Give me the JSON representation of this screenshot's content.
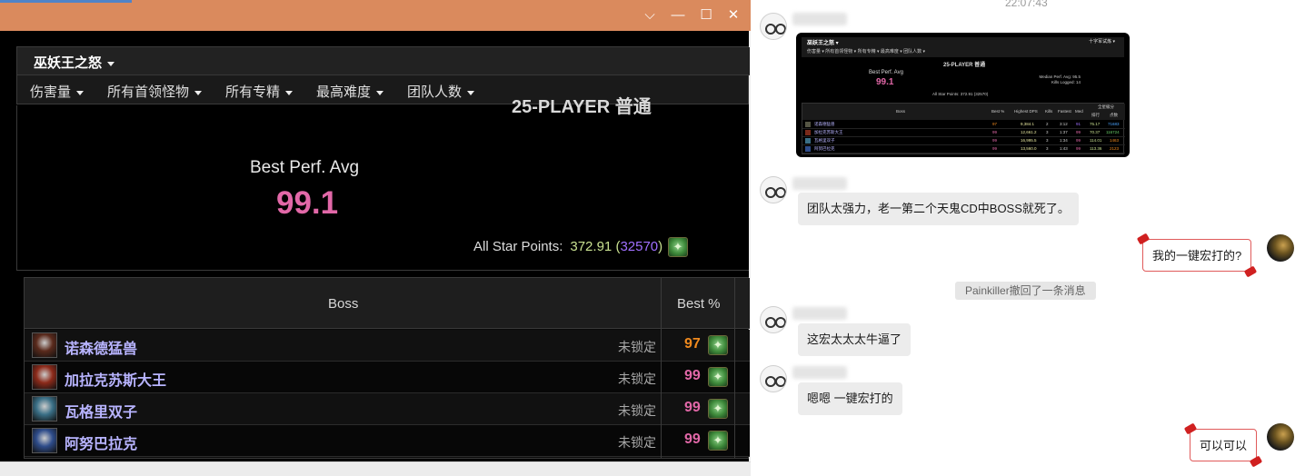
{
  "window": {
    "controls": {
      "minimize": "⌵",
      "restore": "—",
      "maximize": "☐",
      "close": "✕"
    }
  },
  "nav": {
    "zone": "巫妖王之怒",
    "filters": [
      "伤害量",
      "所有首领怪物",
      "所有专精",
      "最高难度",
      "团队人数"
    ]
  },
  "summary": {
    "difficulty": "25-PLAYER 普通",
    "best_perf_label": "Best Perf. Avg",
    "best_perf_value": "99.1",
    "all_star_label": "All Star Points:",
    "all_star_value": "372.91",
    "all_star_open": "(",
    "all_star_rank": "32570",
    "all_star_close": ")"
  },
  "table": {
    "headers": {
      "boss": "Boss",
      "best": "Best %"
    },
    "rows": [
      {
        "name": "诺森德猛兽",
        "lock": "未锁定",
        "best": "97",
        "best_color": "#f08a1e",
        "icon_color": "#5a2a1c"
      },
      {
        "name": "加拉克苏斯大王",
        "lock": "未锁定",
        "best": "99",
        "best_color": "#e268a8",
        "icon_color": "#8c2a1a"
      },
      {
        "name": "瓦格里双子",
        "lock": "未锁定",
        "best": "99",
        "best_color": "#e268a8",
        "icon_color": "#3a6f86"
      },
      {
        "name": "阿努巴拉克",
        "lock": "未锁定",
        "best": "99",
        "best_color": "#e268a8",
        "icon_color": "#2e4c8a"
      }
    ]
  },
  "chat": {
    "time": "22:07:43",
    "messages": {
      "m1": "团队太强力，老一第二个天鬼CD中BOSS就死了。",
      "m2": "我的一键宏打的?",
      "recall": "Painkiller撤回了一条消息",
      "m3": "这宏太太太牛逼了",
      "m4": "嗯嗯 一键宏打的",
      "m5": "可以可以"
    },
    "mini": {
      "zone": "巫妖王之怒 ▾",
      "filters": "伤害量 ▾    所有首领怪物 ▾    所有专精 ▾    最高难度 ▾    团队人数 ▾",
      "corner": "十字军试炼 ▾",
      "difficulty": "25-PLAYER 普通",
      "bpa_label": "Best Perf. Avg",
      "bpa": "99.1",
      "median_label": "Median Perf. Avg: 95.5",
      "kills_label": "Kills Logged: 14",
      "asp": "All Star Points: 372.91 (32570)",
      "headers": {
        "boss": "Boss",
        "best": "Best %",
        "dps": "Highest DPS",
        "kills": "Kills",
        "fastest": "Fastest",
        "med": "Med",
        "allstar": "全星級分",
        "rank": "排行",
        "pts": "点数"
      },
      "rows": [
        {
          "name": "诺森德猛兽",
          "best": "97",
          "dps": "9,384.1",
          "kills": "2",
          "fastest": "3:12",
          "med": "91",
          "rank": "75.17",
          "pts": "71683"
        },
        {
          "name": "加拉克苏斯大王",
          "best": "99",
          "dps": "12,661.2",
          "kills": "3",
          "fastest": "1:37",
          "med": "99",
          "rank": "70.37",
          "pts": "116724"
        },
        {
          "name": "瓦格里双子",
          "best": "99",
          "dps": "16,995.5",
          "kills": "3",
          "fastest": "1:34",
          "med": "99",
          "rank": "114.01",
          "pts": "1463"
        },
        {
          "name": "阿努巴拉克",
          "best": "99",
          "dps": "13,560.0",
          "kills": "3",
          "fastest": "1:43",
          "med": "99",
          "rank": "113.36",
          "pts": "2123"
        }
      ]
    }
  }
}
